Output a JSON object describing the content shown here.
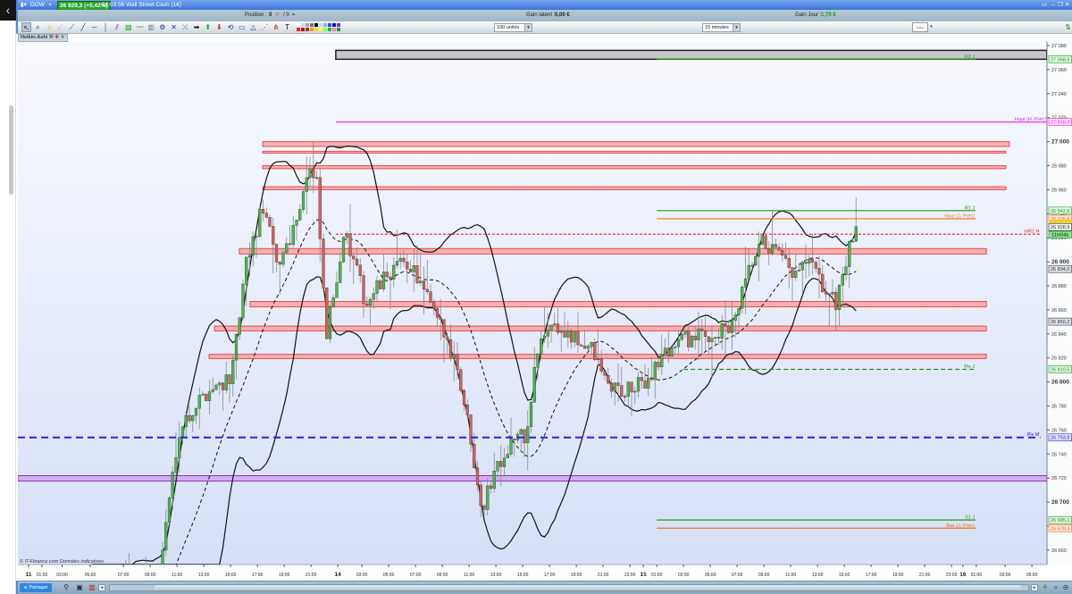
{
  "window": {
    "instrument": "DOW",
    "quote_badge": "26 929,3 (+0,42%)",
    "time_title": "16:03:56 Wall Street Cash (1€)"
  },
  "position_bar": {
    "position_label": "Position :",
    "position_value": "0",
    "position_total": "/ 0",
    "gain_latent_label": "Gain latent :",
    "gain_latent_value": "0,00 €",
    "gain_jour_label": "Gain Jour :",
    "gain_jour_value": "1,70 €"
  },
  "toolbar": {
    "tools": [
      "pointer-icon",
      "zoom-icon",
      "alert-bell-icon",
      "ruler-icon",
      "segment-icon",
      "line-icon",
      "horizontal-line-icon",
      "vertical-line-icon",
      "parallel-channel-icon",
      "fibonacci-icon",
      "wave-icon",
      "trash-icon",
      "settings-icon",
      "cross-line-icon",
      "trend-cross-icon",
      "arrow-right-icon",
      "arrow-up-icon",
      "arrow-down-icon",
      "rectangle-rotate-icon",
      "rectangle-icon",
      "triangle-icon",
      "fan-icon",
      "pitchfork-icon",
      "text-icon"
    ],
    "quantity_select": "100 unités",
    "period_select": "15 minutes",
    "swatches": [
      "#ffffff",
      "#d8d8d8",
      "#a8a8a8",
      "#707070",
      "#000000",
      "#c8d8ff",
      "#9bb0ff",
      "#3050ff",
      "#1010c0",
      "#8a2be2",
      "#ff2020",
      "#c01010",
      "#8b4513",
      "#ff9020",
      "#ffd020",
      "#ffff40",
      "#80ff80",
      "#20c020",
      "#ff80c0",
      "#00a040"
    ]
  },
  "indicator_label": "Heikin-Ashi",
  "copyright": "© IT-Finance.com Données indicatives",
  "bottom": {
    "share_label": "Partager"
  },
  "timer": "11m04s",
  "colors": {
    "up": "#4cb84c",
    "down": "#d9605a",
    "zone": "#f4a6a6",
    "accent": "#2d86e0"
  },
  "chart_data": {
    "type": "candlestick",
    "title": "DOW 15 minutes Heikin-Ashi",
    "x_unit": "15-minute bar index",
    "ylim": [
      26650,
      27085
    ],
    "y_ticks": [
      27080,
      27060,
      27040,
      27020,
      27000,
      26980,
      26960,
      26940,
      26920,
      26900,
      26880,
      26860,
      26840,
      26820,
      26800,
      26780,
      26760,
      26740,
      26720,
      26700,
      26680,
      26660
    ],
    "y_tick_labels": [
      "27 080",
      "27 060",
      "27 040",
      "27 020",
      "27 000",
      "26 980",
      "26 960",
      "26 940",
      "26 920",
      "26 900",
      "26 880",
      "26 860",
      "26 840",
      "26 820",
      "26 800",
      "26 780",
      "26 760",
      "26 740",
      "26 720",
      "26 700",
      "26 680",
      "26 660"
    ],
    "x_ticks": [
      {
        "label": "11",
        "bar": 0,
        "day": true
      },
      {
        "label": "01:00",
        "bar": 4
      },
      {
        "label": "03:00",
        "bar": 10
      },
      {
        "label": "05:00",
        "bar": 18.4
      },
      {
        "label": "07:00",
        "bar": 28.3
      },
      {
        "label": "09:00",
        "bar": 36.3
      },
      {
        "label": "11:00",
        "bar": 44.3
      },
      {
        "label": "13:00",
        "bar": 52.3
      },
      {
        "label": "15:00",
        "bar": 60.3
      },
      {
        "label": "17:00",
        "bar": 68.3
      },
      {
        "label": "19:00",
        "bar": 76.3
      },
      {
        "label": "21:00",
        "bar": 84.3
      },
      {
        "label": "14",
        "bar": 92.3,
        "day": true
      },
      {
        "label": "03:00",
        "bar": 99.5
      },
      {
        "label": "05:00",
        "bar": 107.5
      },
      {
        "label": "07:00",
        "bar": 115.5
      },
      {
        "label": "09:00",
        "bar": 123.5
      },
      {
        "label": "11:00",
        "bar": 131.5
      },
      {
        "label": "13:00",
        "bar": 139.5
      },
      {
        "label": "15:00",
        "bar": 147.5
      },
      {
        "label": "17:00",
        "bar": 155.5
      },
      {
        "label": "19:00",
        "bar": 163.5
      },
      {
        "label": "21:00",
        "bar": 171.5
      },
      {
        "label": "23:00",
        "bar": 179.5
      },
      {
        "label": "15",
        "bar": 183.5,
        "day": true
      },
      {
        "label": "01:00",
        "bar": 187.5
      },
      {
        "label": "03:00",
        "bar": 195.5
      },
      {
        "label": "05:00",
        "bar": 203.5
      },
      {
        "label": "07:00",
        "bar": 211.5
      },
      {
        "label": "09:00",
        "bar": 219.5
      },
      {
        "label": "11:00",
        "bar": 227.5
      },
      {
        "label": "13:00",
        "bar": 235.5
      },
      {
        "label": "15:00",
        "bar": 243.5
      },
      {
        "label": "17:00",
        "bar": 251.5
      },
      {
        "label": "19:00",
        "bar": 259.5
      },
      {
        "label": "21:00",
        "bar": 267.5
      },
      {
        "label": "23:00",
        "bar": 275.5
      },
      {
        "label": "16",
        "bar": 278.9,
        "day": true
      },
      {
        "label": "01:00",
        "bar": 282.9
      },
      {
        "label": "03:00",
        "bar": 291.5
      },
      {
        "label": "05:00",
        "bar": 299.5
      }
    ],
    "price_path": [
      [
        0,
        26560
      ],
      [
        20,
        26590
      ],
      [
        30,
        26640
      ],
      [
        36,
        26620
      ],
      [
        39.5,
        26650
      ],
      [
        44.8,
        26761
      ],
      [
        52.8,
        26791
      ],
      [
        60.8,
        26806
      ],
      [
        64.8,
        26895
      ],
      [
        70.1,
        26947
      ],
      [
        74.1,
        26895
      ],
      [
        79.5,
        26932
      ],
      [
        83.5,
        26977
      ],
      [
        86.1,
        26962
      ],
      [
        88.8,
        26835
      ],
      [
        94.1,
        26925
      ],
      [
        100.8,
        26865
      ],
      [
        108.8,
        26895
      ],
      [
        114.1,
        26898
      ],
      [
        122.1,
        26850
      ],
      [
        127.5,
        26820
      ],
      [
        131.5,
        26761
      ],
      [
        135.5,
        26694
      ],
      [
        139.5,
        26731
      ],
      [
        144.8,
        26753
      ],
      [
        148.8,
        26755
      ],
      [
        151.5,
        26820
      ],
      [
        155.5,
        26850
      ],
      [
        162.1,
        26835
      ],
      [
        167.5,
        26830
      ],
      [
        172.8,
        26798
      ],
      [
        178.1,
        26791
      ],
      [
        183.5,
        26798
      ],
      [
        188.8,
        26820
      ],
      [
        194.1,
        26835
      ],
      [
        202.1,
        26838
      ],
      [
        210.1,
        26845
      ],
      [
        215.5,
        26895
      ],
      [
        219.5,
        26917
      ],
      [
        223.5,
        26905
      ],
      [
        228.8,
        26887
      ],
      [
        232.8,
        26900
      ],
      [
        236.8,
        26880
      ],
      [
        240.8,
        26865
      ],
      [
        243.5,
        26895
      ],
      [
        247,
        26929.3
      ]
    ],
    "indicators": {
      "bollinger": {
        "period": 20,
        "stddev": 2
      },
      "moving_average": {
        "period": 20,
        "style": "dashed"
      }
    },
    "zones": [
      {
        "name": "gray-zone",
        "top": 27076,
        "bottom": 27068.6,
        "start_bar": 91.7,
        "end_bar": 304,
        "fill": "#bdbdbd",
        "stroke": "#222222"
      },
      {
        "name": "resistance-zone",
        "top": 27000,
        "bottom": 26996,
        "start_bar": 69.9,
        "end_bar": 292.8,
        "fill": "#f4a6a6",
        "stroke": "#e84a4a"
      },
      {
        "name": "resistance-zone",
        "top": 26992,
        "bottom": 26990.5,
        "start_bar": 69.9,
        "end_bar": 291.7,
        "fill": "#f4a6a6",
        "stroke": "#e84a4a"
      },
      {
        "name": "resistance-zone",
        "top": 26980,
        "bottom": 26977.5,
        "start_bar": 69.9,
        "end_bar": 291.7,
        "fill": "#f4a6a6",
        "stroke": "#e84a4a"
      },
      {
        "name": "resistance-zone",
        "top": 26962.5,
        "bottom": 26960,
        "start_bar": 69.9,
        "end_bar": 291.7,
        "fill": "#f4a6a6",
        "stroke": "#e84a4a"
      },
      {
        "name": "resistance-zone",
        "top": 26911,
        "bottom": 26906.5,
        "start_bar": 62.9,
        "end_bar": 285.9,
        "fill": "#f4a6a6",
        "stroke": "#e84a4a"
      },
      {
        "name": "resistance-zone",
        "top": 26867,
        "bottom": 26862.5,
        "start_bar": 66.1,
        "end_bar": 285.9,
        "fill": "#f4a6a6",
        "stroke": "#e84a4a"
      },
      {
        "name": "resistance-zone",
        "top": 26846.5,
        "bottom": 26842.5,
        "start_bar": 55.5,
        "end_bar": 285.9,
        "fill": "#f4a6a6",
        "stroke": "#e84a4a"
      },
      {
        "name": "resistance-zone",
        "top": 26823,
        "bottom": 26819.5,
        "start_bar": 53.9,
        "end_bar": 285.9,
        "fill": "#f4a6a6",
        "stroke": "#e84a4a"
      },
      {
        "name": "purple-zone",
        "top": 26722,
        "bottom": 26717.5,
        "start_bar": -4,
        "end_bar": 304,
        "fill": "#cfa6ee",
        "stroke": "#8a2bc9"
      }
    ],
    "levels": [
      {
        "label": "R2 J",
        "price": 27068.6,
        "value_text": "27 068,6",
        "color": "#1c9a1c",
        "style": "solid",
        "start_bar": 187.5,
        "end_bar": 282.7
      },
      {
        "label": "Haut (H. Préc)",
        "price": 27016.3,
        "value_text": "27 016,3",
        "color": "#ee1cee",
        "style": "solid",
        "start_bar": 91.7,
        "end_bar": 304
      },
      {
        "label": "R1 J",
        "price": 26942.6,
        "value_text": "26 942,6",
        "color": "#1c9a1c",
        "style": "solid",
        "start_bar": 187.5,
        "end_bar": 282.7
      },
      {
        "label": "Haut (J, Préc)",
        "price": 26935.8,
        "value_text": "26 935,8",
        "color": "#f07020",
        "style": "solid",
        "start_bar": 187.5,
        "end_bar": 282.7
      },
      {
        "label": "mR1 H",
        "price": 26923,
        "value_text": "26 928,9",
        "color": "#ee2020",
        "style": "dotted",
        "start_bar": 91.7,
        "end_bar": 302
      },
      {
        "label": "Piv J",
        "price": 26810.5,
        "value_text": "26 810,5",
        "color": "#1c9a1c",
        "style": "dashed",
        "start_bar": 195.5,
        "end_bar": 282.7
      },
      {
        "label": "Piv M",
        "price": 26753.8,
        "value_text": "26 753,8",
        "color": "#2020ee",
        "style": "bigdash",
        "start_bar": -4,
        "end_bar": 302
      },
      {
        "label": "S1 J",
        "price": 26685.1,
        "value_text": "26 685,1",
        "color": "#1c9a1c",
        "style": "solid",
        "start_bar": 187.5,
        "end_bar": 282.7
      },
      {
        "label": "Bas (J, Préc)",
        "price": 26678.3,
        "value_text": "26 678,3",
        "color": "#f07020",
        "style": "solid",
        "start_bar": 187.5,
        "end_bar": 282.7
      }
    ],
    "axis_boxes": [
      {
        "text": "27 068,6",
        "price": 27068.6,
        "color": "#1c9a1c",
        "bg": "#e2f5e2"
      },
      {
        "text": "27 016,3",
        "price": 27016.3,
        "color": "#ee1cee",
        "bg": "#fbe2fb"
      },
      {
        "text": "26 942,6",
        "price": 26942.6,
        "color": "#1c9a1c",
        "bg": "#e2f5e2"
      },
      {
        "text": "26 935,8",
        "price": 26935.8,
        "color": "#f07020",
        "bg": "#fde8da"
      },
      {
        "text": "26 928,9",
        "price": 26928.9,
        "color": "#111111",
        "bg": "#ffffff"
      },
      {
        "text": "26 894,0",
        "price": 26894.0,
        "color": "#333333",
        "bg": "#dde3ea"
      },
      {
        "text": "26 850,2",
        "price": 26850.2,
        "color": "#333333",
        "bg": "#dde3ea"
      },
      {
        "text": "26 810,5",
        "price": 26810.5,
        "color": "#1c9a1c",
        "bg": "#e2f5e2"
      },
      {
        "text": "26 753,8",
        "price": 26753.8,
        "color": "#2020ee",
        "bg": "#e2e4fb"
      },
      {
        "text": "26 685,1",
        "price": 26685.1,
        "color": "#1c9a1c",
        "bg": "#e2f5e2"
      },
      {
        "text": "26 678,3",
        "price": 26678.3,
        "color": "#f07020",
        "bg": "#fde8da"
      }
    ],
    "last_price": 26929.3
  }
}
